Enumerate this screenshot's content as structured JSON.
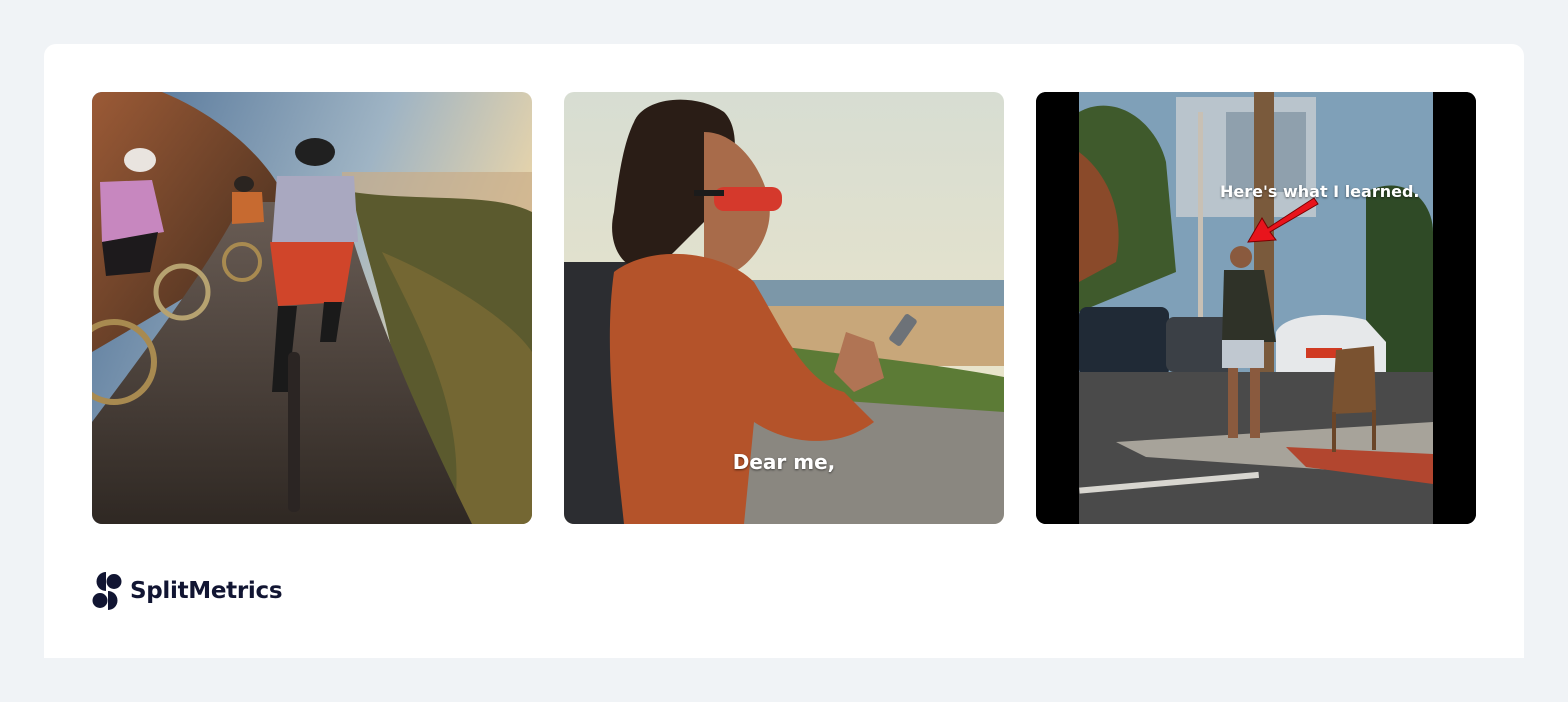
{
  "gallery": {
    "items": [
      {
        "image": "cyclists-coastal-road-sunset",
        "caption": ""
      },
      {
        "image": "woman-phone-beach-sunglasses",
        "caption": "Dear me,"
      },
      {
        "image": "man-street-corner-red-arrow",
        "caption": "Here's what I learned."
      }
    ]
  },
  "brand": {
    "name": "SplitMetrics",
    "color": "#111532"
  },
  "colors": {
    "page_background": "#f0f3f6",
    "card_background": "#ffffff",
    "arrow": "#e8141c"
  }
}
